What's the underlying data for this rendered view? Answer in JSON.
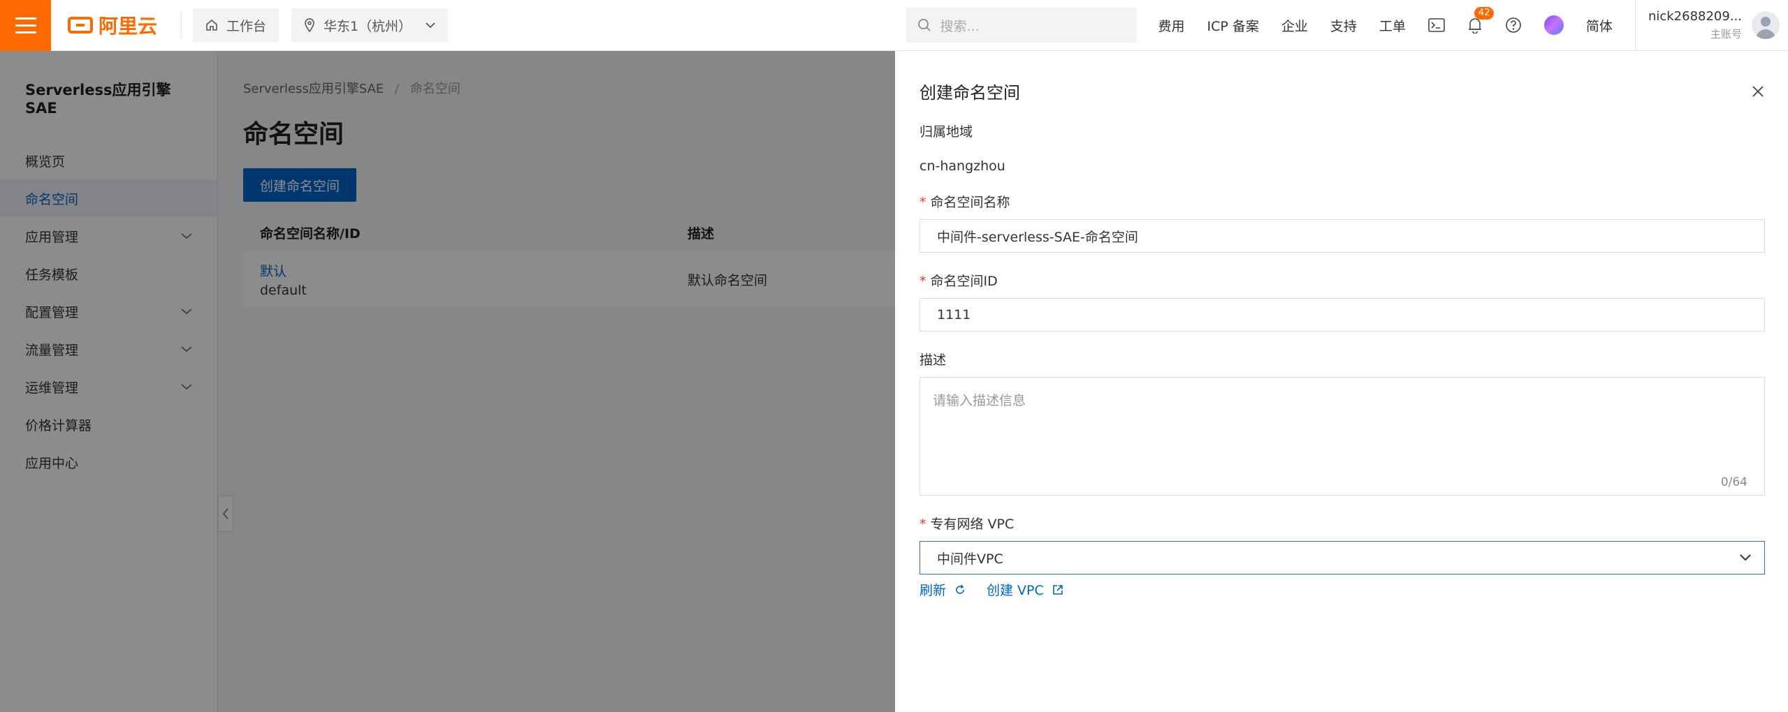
{
  "topbar": {
    "logo_text": "阿里云",
    "workbench_label": "工作台",
    "region_label": "华东1（杭州）",
    "search_placeholder": "搜索...",
    "links": [
      "费用",
      "ICP 备案",
      "企业",
      "支持",
      "工单"
    ],
    "notification_count": "42",
    "language_label": "简体",
    "user_name": "nick2688209...",
    "user_role": "主账号",
    "brand_color": "#ff6a00"
  },
  "sidebar": {
    "title": "Serverless应用引擎SAE",
    "items": [
      {
        "label": "概览页"
      },
      {
        "label": "命名空间"
      },
      {
        "label": "应用管理"
      },
      {
        "label": "任务模板"
      },
      {
        "label": "配置管理"
      },
      {
        "label": "流量管理"
      },
      {
        "label": "运维管理"
      },
      {
        "label": "价格计算器"
      },
      {
        "label": "应用中心"
      }
    ]
  },
  "main": {
    "breadcrumb_root": "Serverless应用引擎SAE",
    "breadcrumb_sep": "/",
    "breadcrumb_current": "命名空间",
    "page_title": "命名空间",
    "create_button": "创建命名空间",
    "table": {
      "headers": [
        "命名空间名称/ID",
        "描述"
      ],
      "rows": [
        {
          "name": "默认",
          "id": "default",
          "desc": "默认命名空间"
        }
      ]
    }
  },
  "drawer": {
    "title": "创建命名空间",
    "region_label": "归属地域",
    "region_value": "cn-hangzhou",
    "name_label": "命名空间名称",
    "name_value": "中间件-serverless-SAE-命名空间",
    "id_label": "命名空间ID",
    "id_value": "1111",
    "desc_label": "描述",
    "desc_placeholder": "请输入描述信息",
    "desc_counter": "0/64",
    "vpc_label": "专有网络 VPC",
    "vpc_value": "中间件VPC",
    "refresh_label": "刷新",
    "create_vpc_label": "创建 VPC",
    "required_mark": "*",
    "accent_color": "#0064c8"
  }
}
